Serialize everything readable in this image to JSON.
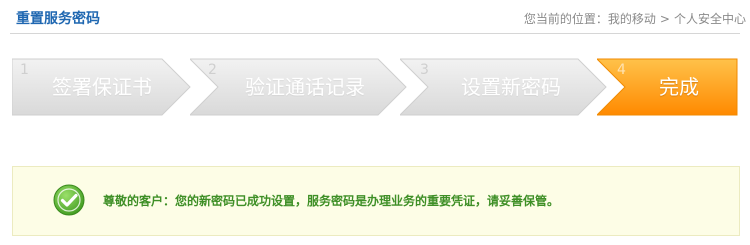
{
  "header": {
    "title": "重置服务密码",
    "breadcrumb": {
      "prefix": "您当前的位置：",
      "items": [
        "我的移动",
        "个人安全中心"
      ],
      "separator": ">"
    }
  },
  "steps": [
    {
      "number": "1",
      "label": "签署保证书",
      "state": "inactive"
    },
    {
      "number": "2",
      "label": "验证通话记录",
      "state": "inactive"
    },
    {
      "number": "3",
      "label": "设置新密码",
      "state": "inactive"
    },
    {
      "number": "4",
      "label": "完成",
      "state": "active"
    }
  ],
  "colors": {
    "title": "#1f67b1",
    "inactive_step": "#e3e3e3",
    "active_step": "#ff9a10",
    "notice_bg": "#fdfde6",
    "notice_text": "#3e8f26",
    "check_icon": "#5ab82c"
  },
  "notice": {
    "icon": "check-circle-icon",
    "message": "尊敬的客户：您的新密码已成功设置，服务密码是办理业务的重要凭证，请妥善保管。"
  }
}
